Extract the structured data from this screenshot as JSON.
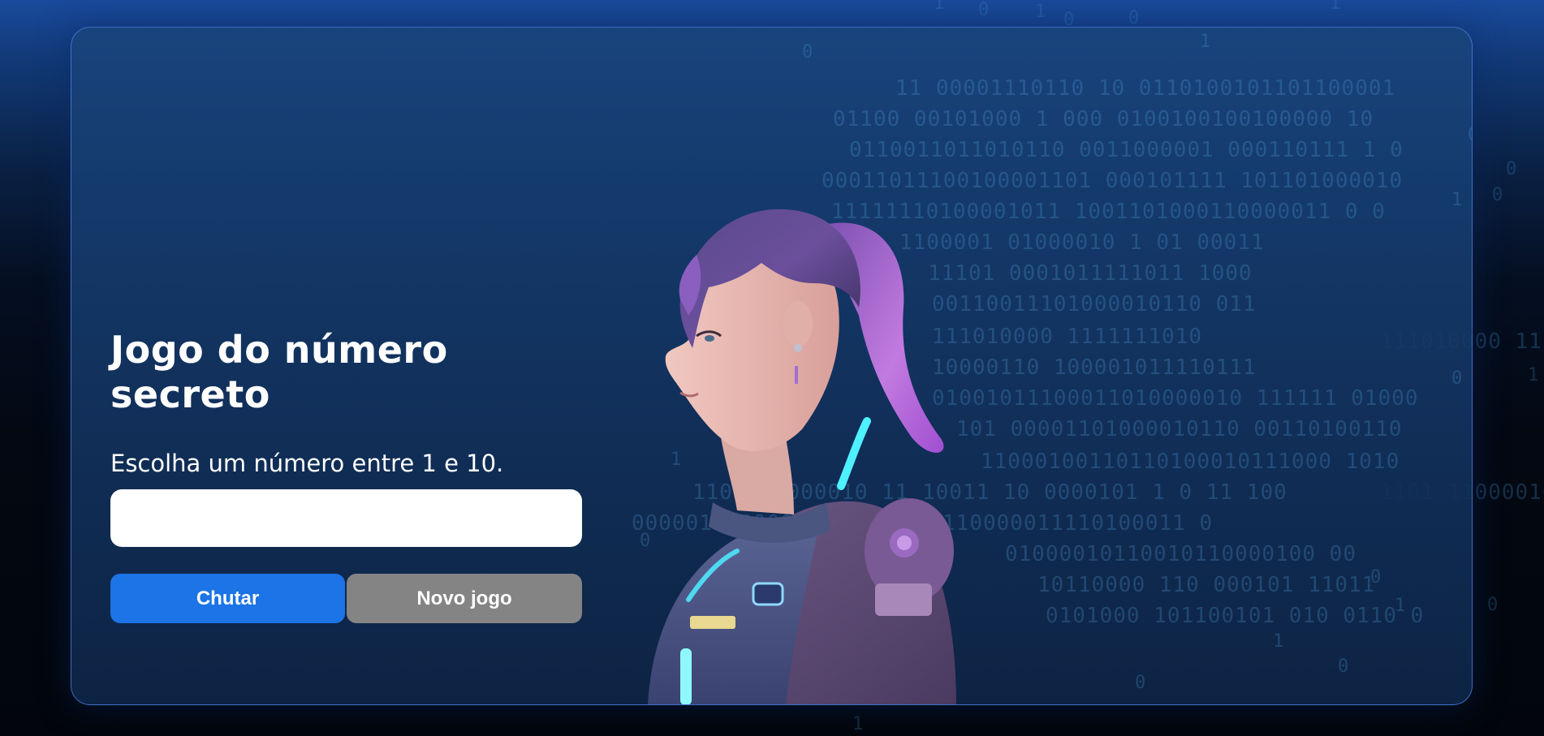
{
  "page": {
    "title": "Jogo do número secreto",
    "instruction": "Escolha um número entre 1 e 10.",
    "input": {
      "value": "",
      "placeholder": ""
    },
    "buttons": {
      "guess_label": "Chutar",
      "new_game_label": "Novo jogo"
    }
  },
  "background": {
    "binary_lines": [
      "11 00001110110 10 0110100101101100001",
      "01100 00101000 1   000 0100100100100000 10",
      "0110011011010110  0011000001 000110111 1 0",
      "00011011100100001101 000101111  101101000010",
      "11111110100001011 1001101000110000011 0 0",
      "1100001 01000010  1 01 00011",
      "11101 0001011111011 1000",
      "00110011101000010110 011",
      "111010000   1111111010",
      "10000110 100001011110111",
      "01001011100011010000010 111111 01000",
      "101 00001101000010110 00110100110",
      "11000100110110100010111000 1010",
      "1101 11000010 11 10011 10 0000101 1 0 11 100",
      "0000011  00001101101  000110000011110100011 0",
      "01000010110010110000100 00",
      "10110000 110 000101 11011",
      "0101000 101100101 010 0110 0"
    ],
    "scattered_digits": [
      "1",
      "0",
      "1",
      "0",
      "0",
      "1",
      "0",
      "0",
      "1",
      "0",
      "1",
      "0",
      "1",
      "0",
      "1",
      "0",
      "1",
      "1",
      "0",
      "0",
      "1",
      "0",
      "1",
      "0"
    ]
  },
  "illustration": {
    "subject": "woman-in-sci-fi-armor-illustration"
  },
  "colors": {
    "accent": "#1c74e6",
    "secondary_button": "#848484",
    "card_border": "#5082e6",
    "binary_text": "#4696d2"
  }
}
